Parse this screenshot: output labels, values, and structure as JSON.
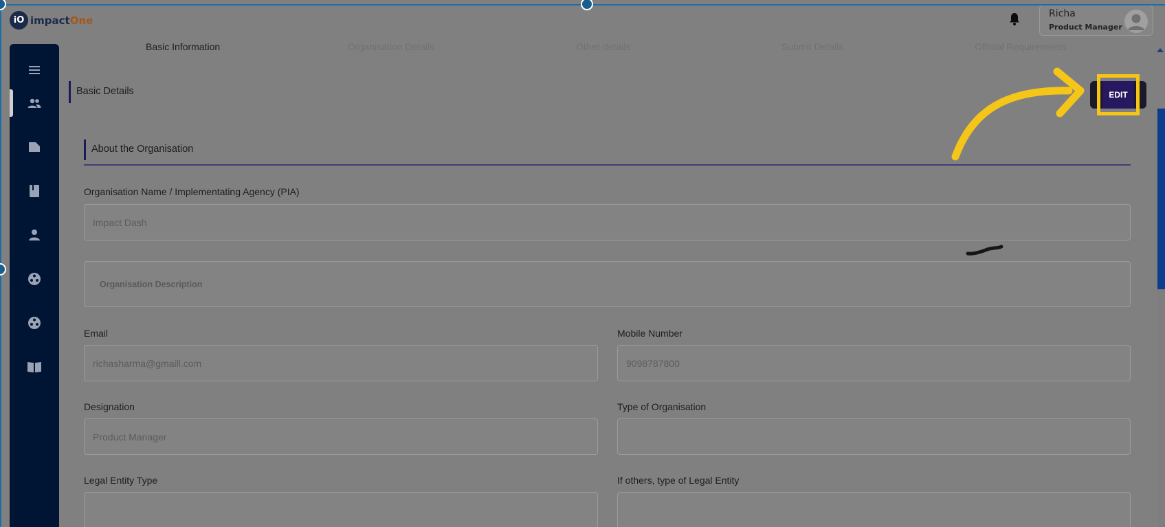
{
  "app": {
    "logo_mark": "iO",
    "logo_text_main": "impact",
    "logo_text_accent": "One"
  },
  "header": {
    "notification_icon": "bell-icon",
    "user_name": "Richa",
    "user_role": "Product Manager",
    "avatar_icon": "user-avatar-icon"
  },
  "sidebar": {
    "items": [
      {
        "icon": "menu-icon"
      },
      {
        "icon": "people-icon",
        "active": true
      },
      {
        "icon": "folder-icon"
      },
      {
        "icon": "book-icon"
      },
      {
        "icon": "person-icon"
      },
      {
        "icon": "film-reel-icon"
      },
      {
        "icon": "film-reel-icon"
      },
      {
        "icon": "open-book-icon"
      }
    ]
  },
  "steps": [
    {
      "label": "Basic Information",
      "active": true
    },
    {
      "label": "Organisation Details",
      "active": false
    },
    {
      "label": "Other details",
      "active": false
    },
    {
      "label": "Submit Details",
      "active": false
    },
    {
      "label": "Official Requirements",
      "active": false
    }
  ],
  "basic_details": {
    "title": "Basic Details",
    "edit_label": "EDIT"
  },
  "about": {
    "title": "About the Organisation"
  },
  "form": {
    "org_name_label": "Organisation Name / Implementating Agency (PIA)",
    "org_name_value": "Impact Dash",
    "org_description_label": "Organisation Description",
    "email_label": "Email",
    "email_value": "richasharma@gmaill.com",
    "mobile_label": "Mobile Number",
    "mobile_value": "9098787800",
    "designation_label": "Designation",
    "designation_value": "Product Manager",
    "org_type_label": "Type of Organisation",
    "org_type_value": "",
    "legal_entity_label": "Legal Entity Type",
    "legal_entity_value": "",
    "legal_other_label": "If others, type of Legal Entity",
    "legal_other_value": ""
  },
  "colors": {
    "sidebar_bg": "#001433",
    "highlight": "#f5c518",
    "edit_button": "#281860",
    "scroll_thumb": "#0d3c8e"
  }
}
